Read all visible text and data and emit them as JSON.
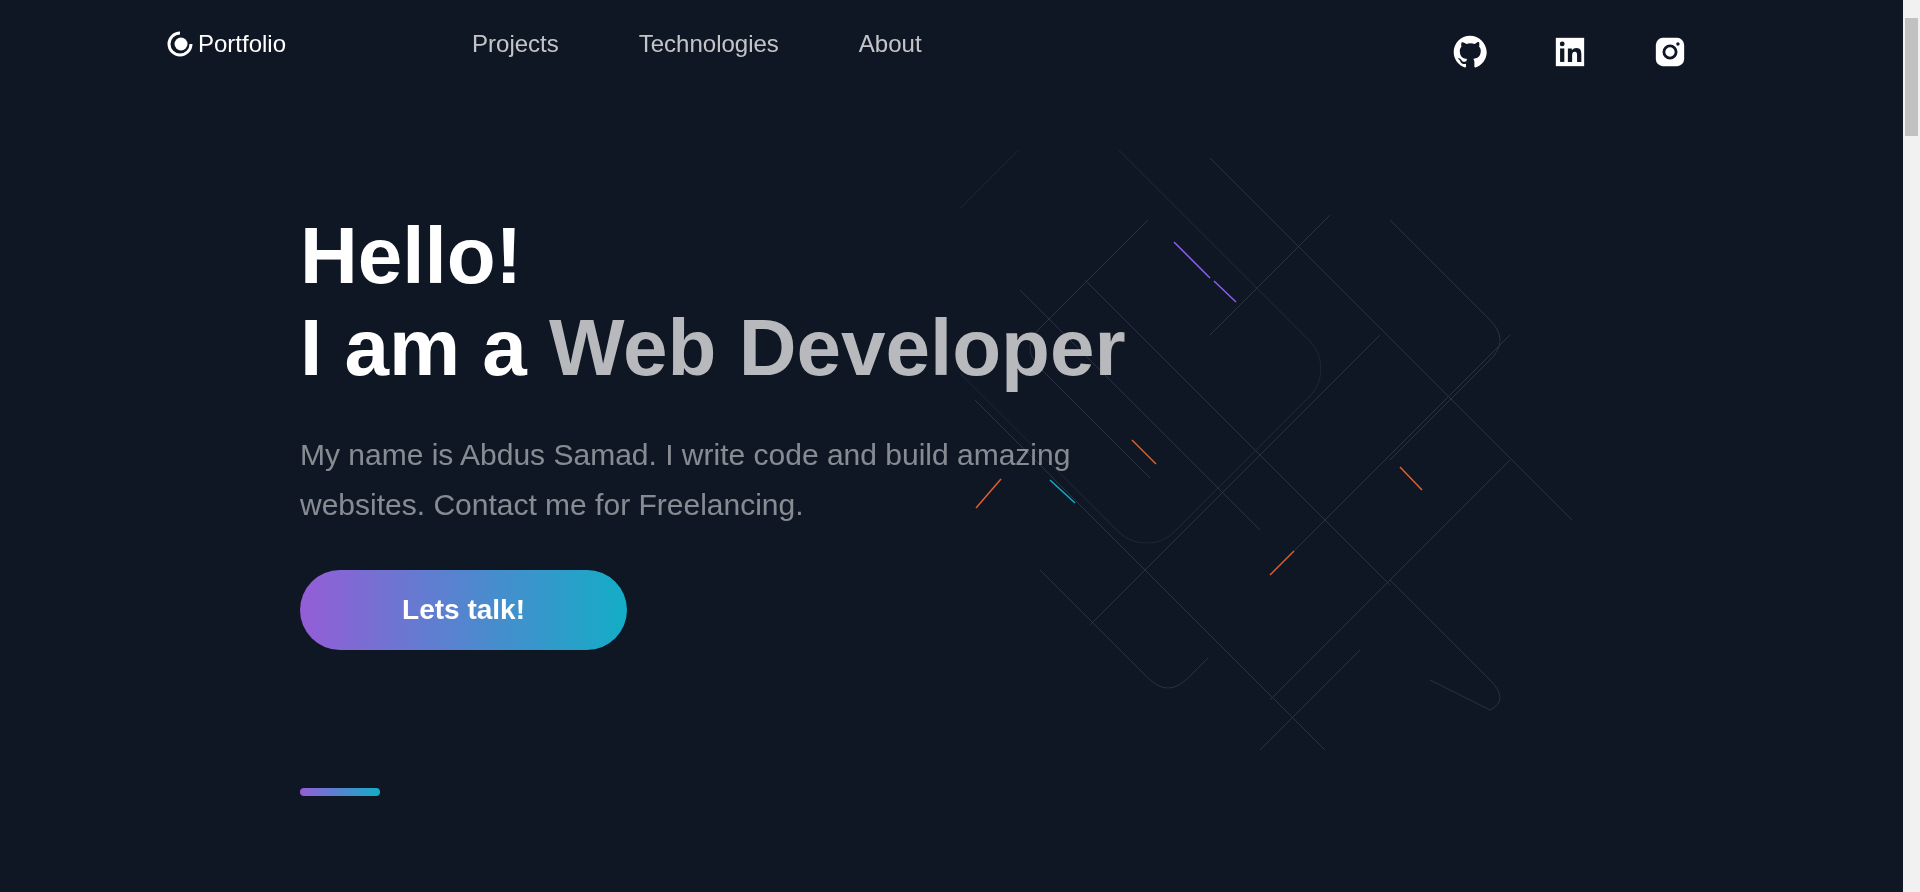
{
  "header": {
    "logo": "Portfolio",
    "nav": [
      {
        "label": "Projects"
      },
      {
        "label": "Technologies"
      },
      {
        "label": "About"
      }
    ],
    "social": [
      {
        "kind": "github"
      },
      {
        "kind": "linkedin"
      },
      {
        "kind": "instagram"
      }
    ]
  },
  "hero": {
    "greeting": "Hello!",
    "headline_lead": "I am a",
    "headline_highlight": "Web Developer",
    "intro": "My name is Abdus Samad. I write code and build amazing websites. Contact me for Freelancing.",
    "cta": "Lets talk!"
  }
}
